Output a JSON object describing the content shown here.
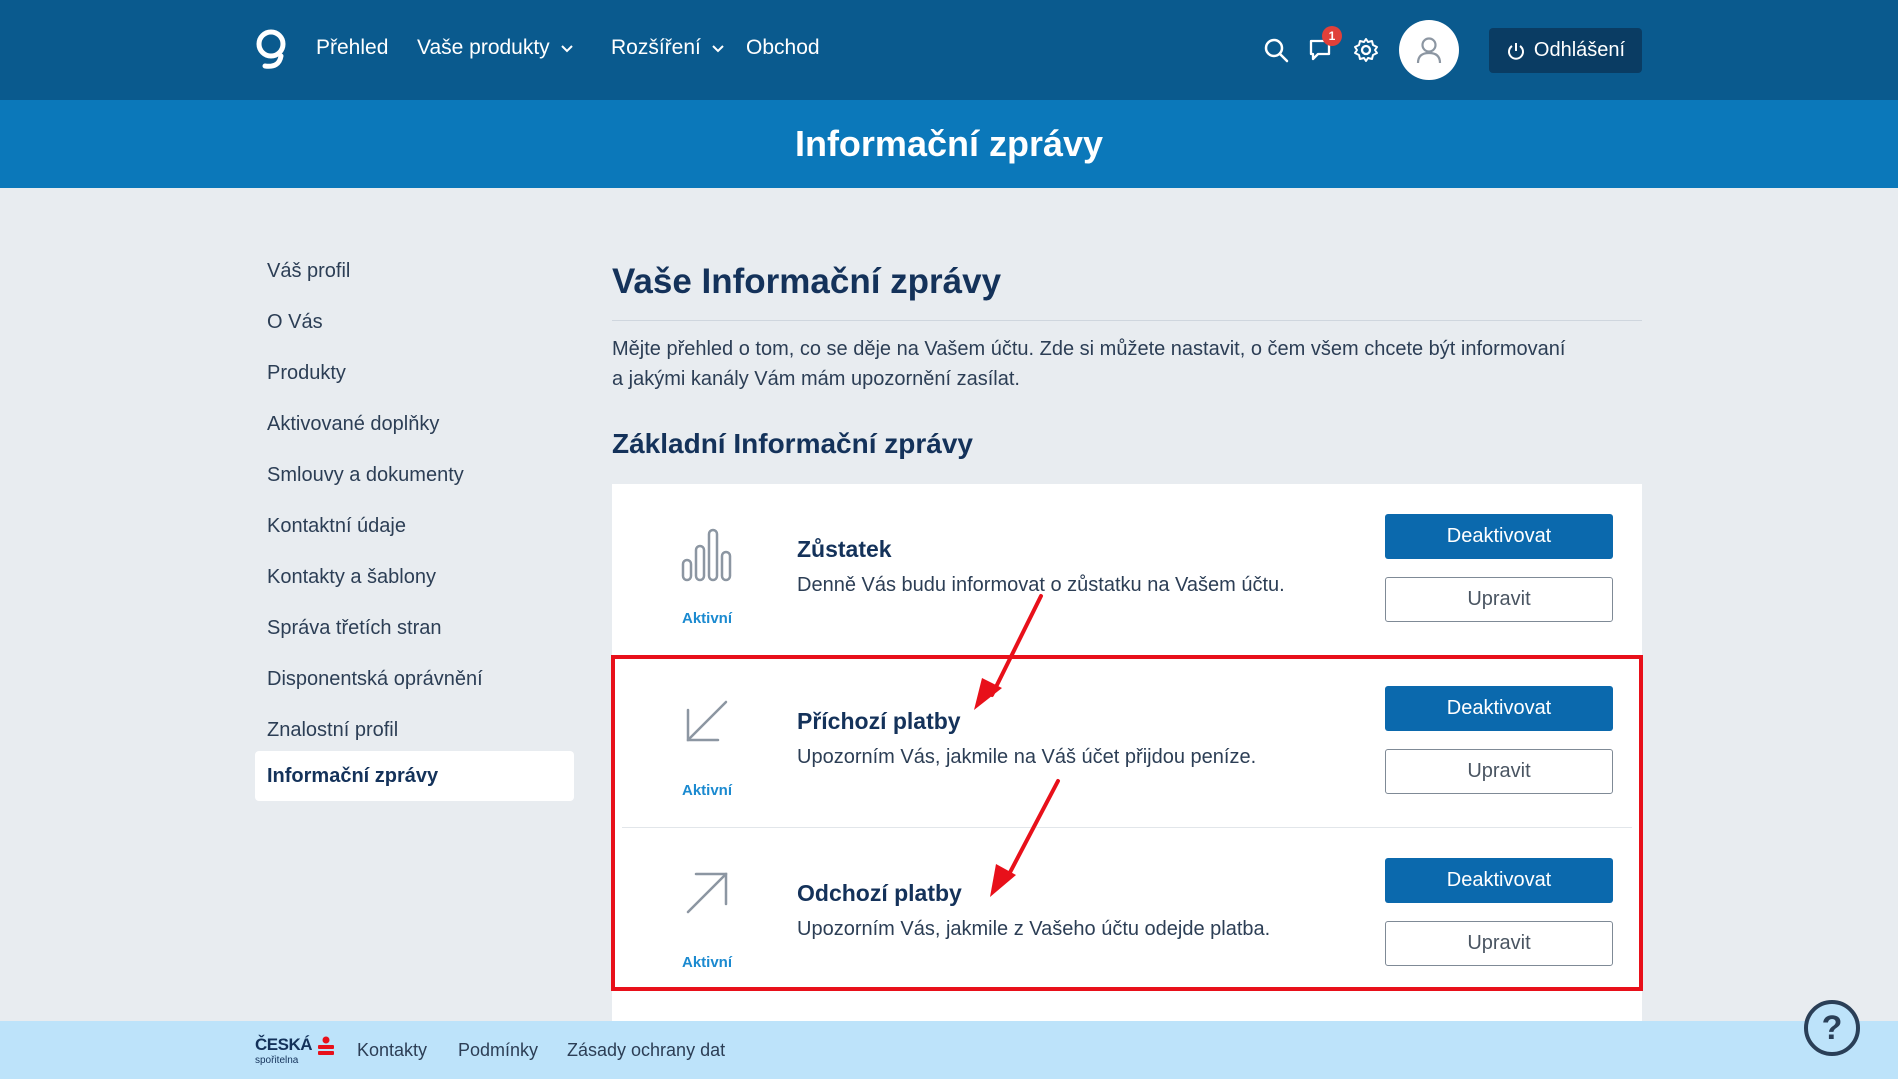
{
  "nav": {
    "items": [
      {
        "label": "Přehled",
        "has_dropdown": false
      },
      {
        "label": "Vaše produkty",
        "has_dropdown": true
      },
      {
        "label": "Rozšíření",
        "has_dropdown": true
      },
      {
        "label": "Obchod",
        "has_dropdown": false
      }
    ],
    "notification_count": "1",
    "logout_label": "Odhlášení",
    "icons": [
      "search-icon",
      "chat-icon",
      "gear-icon",
      "user-icon",
      "power-icon"
    ]
  },
  "page": {
    "band_title": "Informační zprávy",
    "heading": "Vaše Informační zprávy",
    "intro_line1": "Mějte přehled o tom, co se děje na Vašem účtu. Zde si můžete nastavit, o čem všem chcete být informovaní",
    "intro_line2": "a jakými kanály Vám mám upozornění zasílat.",
    "subheading": "Základní Informační zprávy"
  },
  "sidebar": {
    "items": [
      {
        "label": "Váš profil",
        "active": false
      },
      {
        "label": "O Vás",
        "active": false
      },
      {
        "label": "Produkty",
        "active": false
      },
      {
        "label": "Aktivované doplňky",
        "active": false
      },
      {
        "label": "Smlouvy a dokumenty",
        "active": false
      },
      {
        "label": "Kontaktní údaje",
        "active": false
      },
      {
        "label": "Kontakty a šablony",
        "active": false
      },
      {
        "label": "Správa třetích stran",
        "active": false
      },
      {
        "label": "Disponentská oprávnění",
        "active": false
      },
      {
        "label": "Znalostní profil",
        "active": false
      },
      {
        "label": "Informační zprávy",
        "active": true
      }
    ]
  },
  "notifications": [
    {
      "icon": "bar-chart-icon",
      "status": "Aktivní",
      "title": "Zůstatek",
      "description": "Denně Vás budu informovat o zůstatku na Vašem účtu.",
      "primary_label": "Deaktivovat",
      "secondary_label": "Upravit"
    },
    {
      "icon": "arrow-down-left-icon",
      "status": "Aktivní",
      "title": "Příchozí platby",
      "description": "Upozorním Vás, jakmile na Váš účet přijdou peníze.",
      "primary_label": "Deaktivovat",
      "secondary_label": "Upravit"
    },
    {
      "icon": "arrow-up-right-icon",
      "status": "Aktivní",
      "title": "Odchozí platby",
      "description": "Upozorním Vás, jakmile z Vašeho účtu odejde platba.",
      "primary_label": "Deaktivovat",
      "secondary_label": "Upravit"
    }
  ],
  "footer": {
    "brand_line1": "ČESKÁ",
    "brand_line2": "spořitelna",
    "links": [
      "Kontakty",
      "Podmínky",
      "Zásady ochrany dat"
    ],
    "help_symbol": "?"
  },
  "colors": {
    "topbar": "#0a5a8e",
    "titleband": "#0b78ba",
    "primary_button": "#0b69ad",
    "status_active": "#1b8ad0",
    "annotation_red": "#e8101a",
    "footer": "#bde3fa"
  }
}
